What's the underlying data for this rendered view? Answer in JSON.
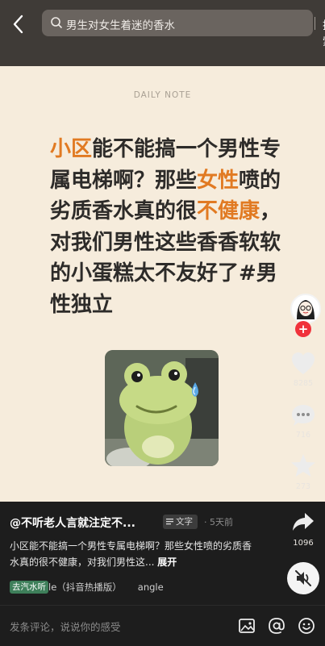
{
  "search": {
    "query": "男生对女生着迷的香水",
    "button": "搜索"
  },
  "post": {
    "daily_label": "DAILY NOTE",
    "headline_segments": [
      {
        "text": "小区",
        "color": "orange"
      },
      {
        "text": "能不能搞一个男性专属电梯啊？那些",
        "color": "dark"
      },
      {
        "text": "女性",
        "color": "orange"
      },
      {
        "text": "喷的劣质香水真的很",
        "color": "dark"
      },
      {
        "text": "不健康",
        "color": "orange"
      },
      {
        "text": "，对我们男性这些香香软软的小蛋糕太不友好了#男性独立",
        "color": "dark"
      }
    ],
    "image_subject": "frog-sticker"
  },
  "actions": {
    "likes": "8285",
    "comments": "716",
    "favorites": "273",
    "shares": "1096"
  },
  "info": {
    "author": "@不听老人言就注定不...",
    "type_tag": "文字",
    "time": "· 5天前",
    "description": "小区能不能搞一个男性专属电梯啊？那些女性喷的劣质香水真的很不健康，对我们男性这...",
    "expand": "展开",
    "music_badge": "去汽水听",
    "music_title": "le（抖音热播版）",
    "music_artist": "angle"
  },
  "bottom": {
    "comment_placeholder": "发条评论，说说你的感受"
  },
  "colors": {
    "accent": "#e17a22",
    "text_dark": "#2d2b29",
    "card_bg": "#f6ecdc",
    "follow_red": "#f0323b"
  }
}
